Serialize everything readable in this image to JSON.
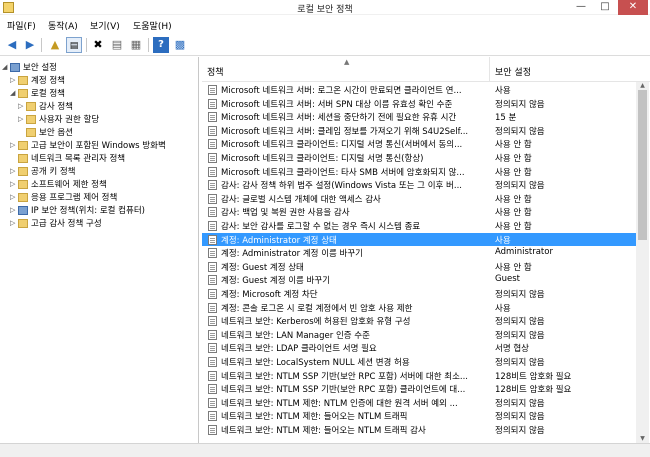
{
  "window": {
    "title": "로컬 보안 정책"
  },
  "menu": [
    "파일(F)",
    "동작(A)",
    "보기(V)",
    "도움말(H)"
  ],
  "toolbar_icons": [
    "back-arrow-icon",
    "forward-arrow-icon",
    "up-folder-icon",
    "show-tree-icon",
    "delete-icon",
    "properties-icon",
    "export-list-icon",
    "help-icon",
    "view-icon"
  ],
  "tree": [
    {
      "label": "보안 설정",
      "level": 0,
      "expanded": true
    },
    {
      "label": "계정 정책",
      "level": 1,
      "expanded": false
    },
    {
      "label": "로컬 정책",
      "level": 1,
      "expanded": true
    },
    {
      "label": "감사 정책",
      "level": 2,
      "expanded": false
    },
    {
      "label": "사용자 권한 할당",
      "level": 2,
      "expanded": false
    },
    {
      "label": "보안 옵션",
      "level": 2,
      "expanded": null
    },
    {
      "label": "고급 보안이 포함된 Windows 방화벽",
      "level": 1,
      "expanded": false
    },
    {
      "label": "네트워크 목록 관리자 정책",
      "level": 1,
      "expanded": null
    },
    {
      "label": "공개 키 정책",
      "level": 1,
      "expanded": false
    },
    {
      "label": "소프트웨어 제한 정책",
      "level": 1,
      "expanded": false
    },
    {
      "label": "응용 프로그램 제어 정책",
      "level": 1,
      "expanded": false
    },
    {
      "label": "IP 보안 정책(위치: 로컬 컴퓨터)",
      "level": 1,
      "expanded": false
    },
    {
      "label": "고급 감사 정책 구성",
      "level": 1,
      "expanded": false
    }
  ],
  "list": {
    "columns": [
      "정책",
      "보안 설정"
    ],
    "selected_index": 12,
    "rows": [
      {
        "policy": "Microsoft 네트워크 서버: 로그온 시간이 만료되면 클라이언트 연...",
        "setting": "사용"
      },
      {
        "policy": "Microsoft 네트워크 서버: 서버 SPN 대상 이름 유효성 확인 수준",
        "setting": "정의되지 않음"
      },
      {
        "policy": "Microsoft 네트워크 서버: 세션을 중단하기 전에 필요한 유휴 시간",
        "setting": "15 분"
      },
      {
        "policy": "Microsoft 네트워크 서버: 클레임 정보를 가져오기 위해 S4U2Self...",
        "setting": "정의되지 않음"
      },
      {
        "policy": "Microsoft 네트워크 클라이언트: 디지털 서명 통신(서버에서 동의...",
        "setting": "사용 안 함"
      },
      {
        "policy": "Microsoft 네트워크 클라이언트: 디지털 서명 통신(항상)",
        "setting": "사용 안 함"
      },
      {
        "policy": "Microsoft 네트워크 클라이언트: 타사 SMB 서버에 암호화되지 않...",
        "setting": "사용 안 함"
      },
      {
        "policy": "감사: 감사 정책 하위 범주 설정(Windows Vista 또는 그 이후 버...",
        "setting": "정의되지 않음"
      },
      {
        "policy": "감사: 글로벌 시스템 개체에 대한 액세스 감사",
        "setting": "사용 안 함"
      },
      {
        "policy": "감사: 백업 및 복원 권한 사용을 감사",
        "setting": "사용 안 함"
      },
      {
        "policy": "감사: 보안 감사를 로그할 수 없는 경우 즉시 시스템 종료",
        "setting": "사용 안 함"
      },
      {
        "policy": "계정: Administrator 계정 상태",
        "setting": "사용"
      },
      {
        "policy": "계정: Administrator 계정 이름 바꾸기",
        "setting": "Administrator"
      },
      {
        "policy": "계정: Guest 계정 상태",
        "setting": "사용 안 함"
      },
      {
        "policy": "계정: Guest 계정 이름 바꾸기",
        "setting": "Guest"
      },
      {
        "policy": "계정: Microsoft 계정 차단",
        "setting": "정의되지 않음"
      },
      {
        "policy": "계정: 콘솔 로그온 시 로컬 계정에서 빈 암호 사용 제한",
        "setting": "사용"
      },
      {
        "policy": "네트워크 보안: Kerberos에 허용된 암호화 유형 구성",
        "setting": "정의되지 않음"
      },
      {
        "policy": "네트워크 보안: LAN Manager 인증 수준",
        "setting": "정의되지 않음"
      },
      {
        "policy": "네트워크 보안: LDAP 클라이언트 서명 필요",
        "setting": "서명 협상"
      },
      {
        "policy": "네트워크 보안: LocalSystem NULL 세션 변경 허용",
        "setting": "정의되지 않음"
      },
      {
        "policy": "네트워크 보안: NTLM SSP 기반(보안 RPC 포함) 서버에 대한 최소...",
        "setting": "128비트 암호화 필요"
      },
      {
        "policy": "네트워크 보안: NTLM SSP 기반(보안 RPC 포함) 클라이언트에 대...",
        "setting": "128비트 암호화 필요"
      },
      {
        "policy": "네트워크 보안: NTLM 제한: NTLM 인증에 대한 원격 서버 예외 ...",
        "setting": "정의되지 않음"
      },
      {
        "policy": "네트워크 보안: NTLM 제한: 들어오는 NTLM 트래픽",
        "setting": "정의되지 않음"
      },
      {
        "policy": "네트워크 보안: NTLM 제한: 들어오는 NTLM 트래픽 감사",
        "setting": "정의되지 않음"
      }
    ]
  }
}
